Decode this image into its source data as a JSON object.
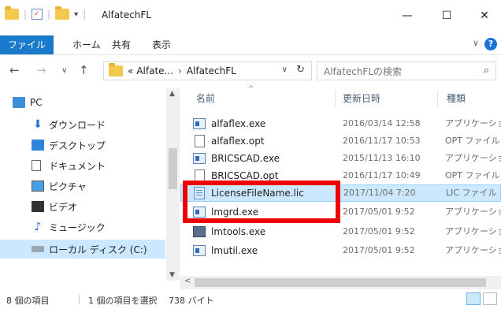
{
  "window": {
    "title": "AlfatechFL",
    "minimize": "—",
    "maximize": "☐",
    "close": "✕"
  },
  "ribbon": {
    "tabs": [
      {
        "label": "ファイル",
        "active": true
      },
      {
        "label": "ホーム"
      },
      {
        "label": "共有"
      },
      {
        "label": "表示"
      }
    ],
    "expand": "∨",
    "help": "?"
  },
  "nav": {
    "back": "←",
    "forward": "→",
    "recent": "∨",
    "up": "↑"
  },
  "address": {
    "prefix": "«",
    "crumb1": "Alfate...",
    "separator": "›",
    "crumb2": "AlfatechFL",
    "dropdown": "∨",
    "refresh": "↻"
  },
  "search": {
    "placeholder": "AlfatechFLの検索",
    "icon": "search-icon",
    "glyph": "⌕"
  },
  "sidebar": {
    "items": [
      {
        "label": "PC",
        "icon": "pc-icon"
      },
      {
        "label": "ダウンロード",
        "icon": "download-icon"
      },
      {
        "label": "デスクトップ",
        "icon": "desktop-icon"
      },
      {
        "label": "ドキュメント",
        "icon": "documents-icon"
      },
      {
        "label": "ピクチャ",
        "icon": "pictures-icon"
      },
      {
        "label": "ビデオ",
        "icon": "videos-icon"
      },
      {
        "label": "ミュージック",
        "icon": "music-icon"
      },
      {
        "label": "ローカル ディスク (C:)",
        "icon": "local-disk-icon",
        "selected": true
      }
    ],
    "download_glyph": "⬇",
    "music_glyph": "♪",
    "scroll_up": "▲",
    "scroll_down": "▼"
  },
  "filelist": {
    "columns": {
      "name": "名前",
      "date": "更新日時",
      "type": "種類"
    },
    "sort_arrow": "^",
    "files": [
      {
        "name": "alfaflex.exe",
        "date": "2016/03/14 12:58",
        "type": "アプリケーション",
        "icon": "exe"
      },
      {
        "name": "alfaflex.opt",
        "date": "2016/11/17 10:53",
        "type": "OPT ファイル",
        "icon": "opt"
      },
      {
        "name": "BRICSCAD.exe",
        "date": "2015/11/13 16:10",
        "type": "アプリケーション",
        "icon": "exe"
      },
      {
        "name": "BRICSCAD.opt",
        "date": "2016/11/17 10:49",
        "type": "OPT ファイル",
        "icon": "opt"
      },
      {
        "name": "LicenseFileName.lic",
        "date": "2017/11/04 7:20",
        "type": "LIC ファイル",
        "icon": "lic",
        "selected": true
      },
      {
        "name": "lmgrd.exe",
        "date": "2017/05/01 9:52",
        "type": "アプリケーション",
        "icon": "exe"
      },
      {
        "name": "lmtools.exe",
        "date": "2017/05/01 9:52",
        "type": "アプリケーション",
        "icon": "tools"
      },
      {
        "name": "lmutil.exe",
        "date": "2017/05/01 9:52",
        "type": "アプリケーション",
        "icon": "exe"
      }
    ],
    "hscroll_left": "<"
  },
  "status": {
    "item_count": "8 個の項目",
    "selected": "1 個の項目を選択",
    "size": "738 バイト"
  },
  "colors": {
    "accent": "#1979ca",
    "selection": "#cce8ff",
    "highlight": "#ee0000"
  }
}
